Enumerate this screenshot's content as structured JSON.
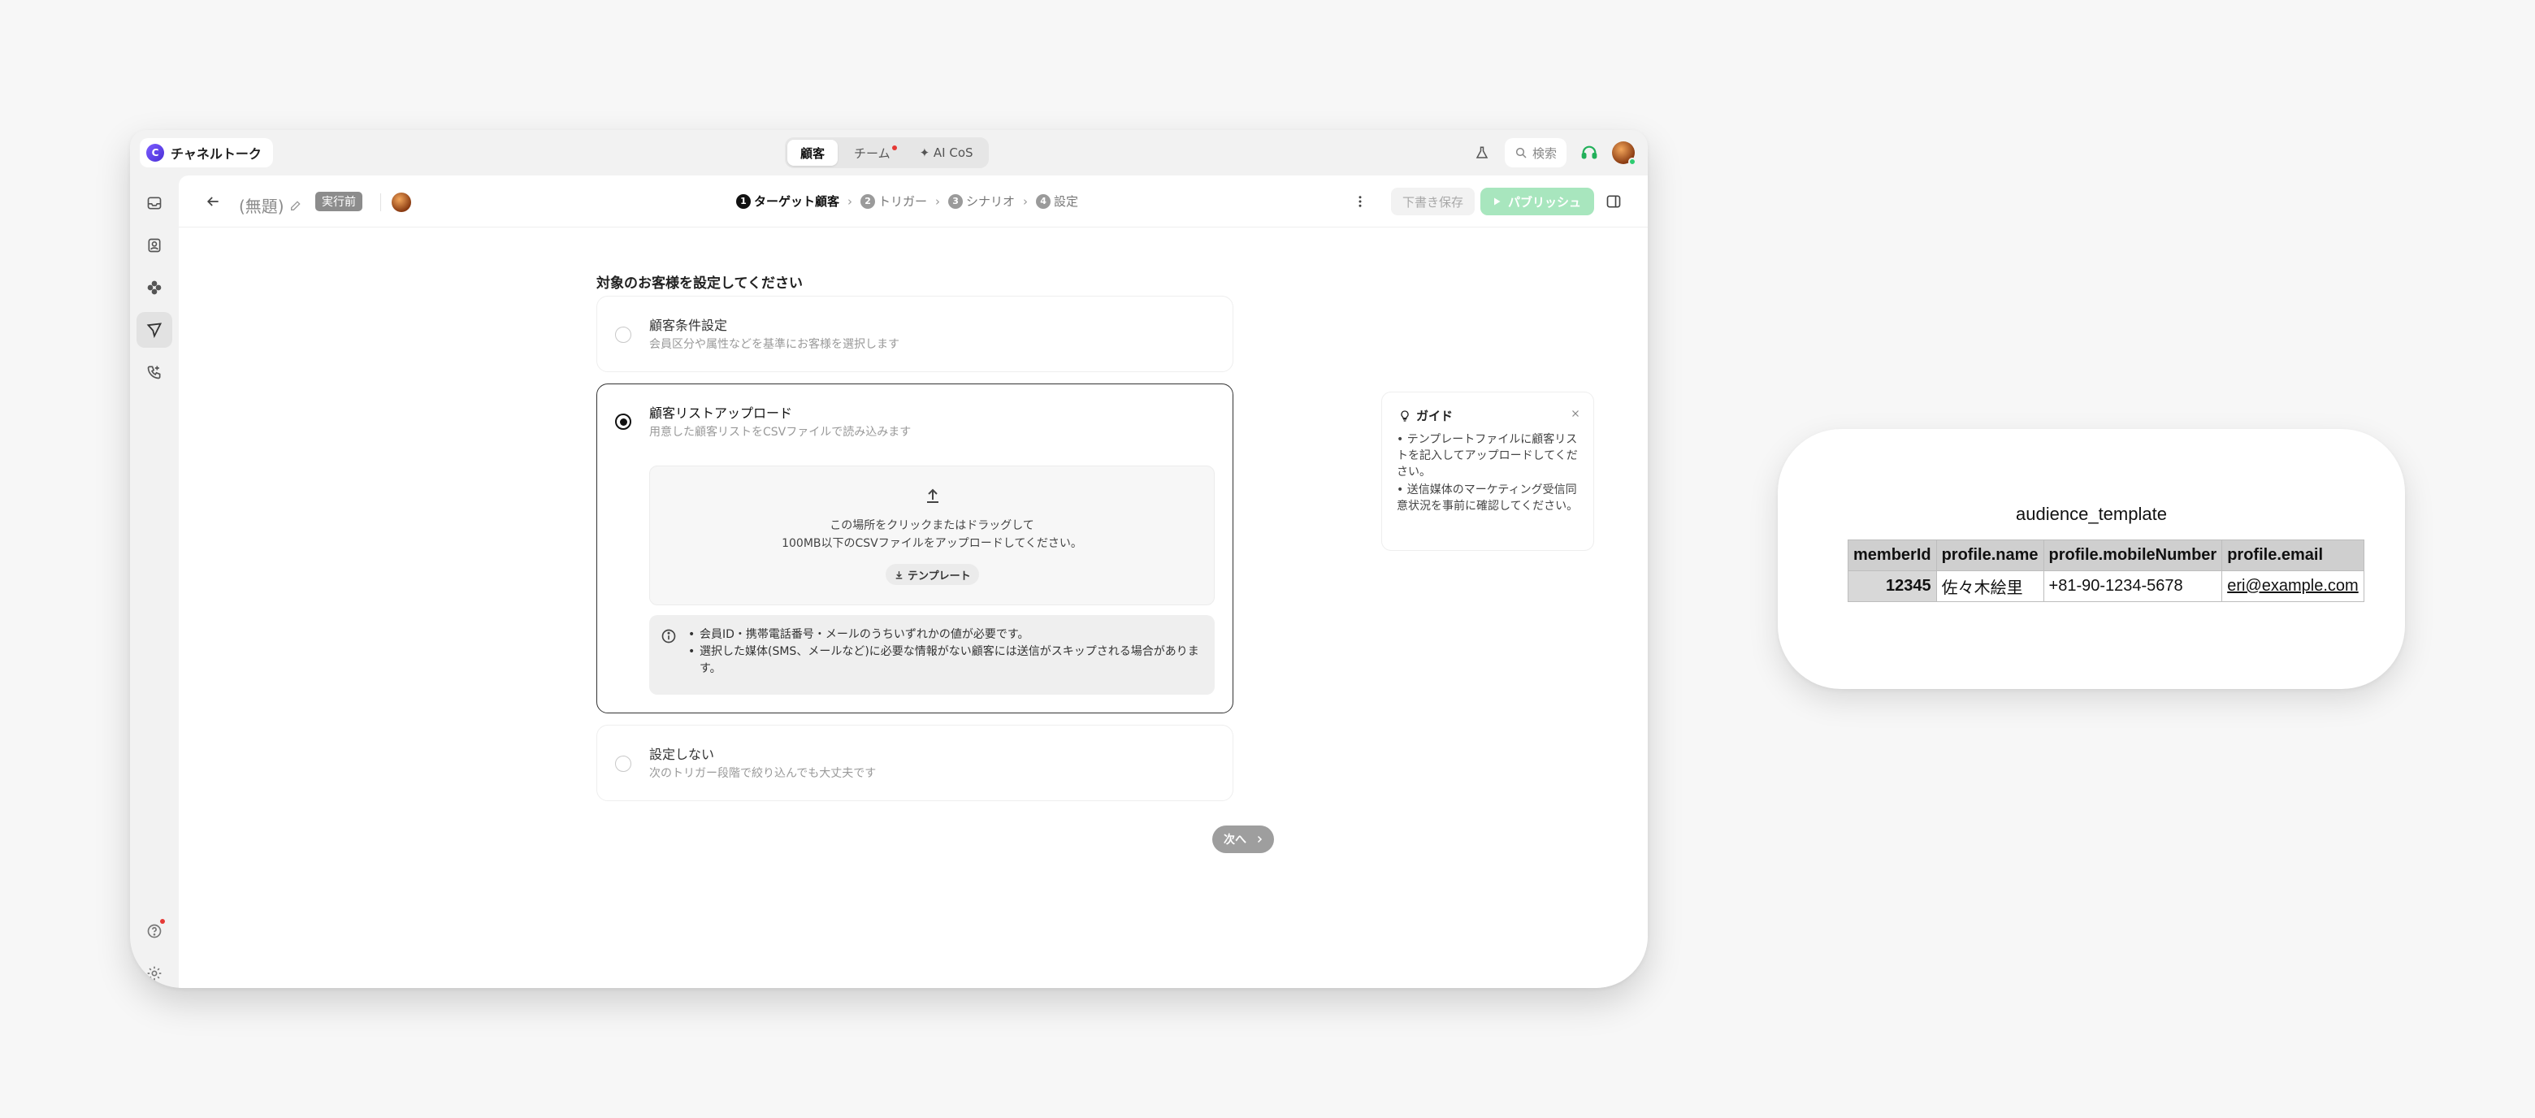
{
  "app": {
    "brand": "チャネルトーク",
    "tabs": [
      {
        "label": "顧客",
        "active": true
      },
      {
        "label": "チーム",
        "has_notification": true
      },
      {
        "label": "✦ AI CoS"
      }
    ],
    "search_placeholder": "検索",
    "icons": {
      "top_right": [
        "flask-icon",
        "search-icon",
        "headset-icon",
        "user-avatar"
      ],
      "sidebar": [
        "inbox-icon",
        "contacts-icon",
        "integrations-icon",
        "campaign-icon",
        "phone-icon",
        "help-icon",
        "settings-icon"
      ]
    },
    "accent": "#2ecc71",
    "notification_color": "#e53935"
  },
  "toolbar": {
    "title": "(無題)",
    "status_badge": "実行前",
    "steps": [
      {
        "num": "1",
        "label": "ターゲット顧客",
        "active": true
      },
      {
        "num": "2",
        "label": "トリガー"
      },
      {
        "num": "3",
        "label": "シナリオ"
      },
      {
        "num": "4",
        "label": "設定"
      }
    ],
    "save_draft": "下書き保存",
    "publish": "パブリッシュ",
    "publish_color": "#a8e6be"
  },
  "content": {
    "heading": "対象のお客様を設定してください",
    "options": [
      {
        "label": "顧客条件設定",
        "desc": "会員区分や属性などを基準にお客様を選択します",
        "selected": false
      },
      {
        "label": "顧客リストアップロード",
        "desc": "用意した顧客リストをCSVファイルで読み込みます",
        "selected": true
      },
      {
        "label": "設定しない",
        "desc": "次のトリガー段階で絞り込んでも大丈夫です",
        "selected": false
      }
    ],
    "dropzone": {
      "line1": "この場所をクリックまたはドラッグして",
      "line2": "100MB以下のCSVファイルをアップロードしてください。",
      "template_button": "テンプレート"
    },
    "notice": [
      "会員ID・携帯電話番号・メールのうちいずれかの値が必要です。",
      "選択した媒体(SMS、メールなど)に必要な情報がない顧客には送信がスキップされる場合があります。"
    ],
    "next_button": "次へ"
  },
  "guide": {
    "title": "ガイド",
    "items": [
      "• テンプレートファイルに顧客リストを記入してアップロードしてください。",
      "• 送信媒体のマーケティング受信同意状況を事前に確認してください。"
    ]
  },
  "template_preview": {
    "title": "audience_template",
    "columns": [
      "memberId",
      "profile.name",
      "profile.mobileNumber",
      "profile.email"
    ],
    "rows": [
      [
        "12345",
        "佐々木絵里",
        "+81-90-1234-5678",
        "eri@example.com"
      ]
    ]
  }
}
